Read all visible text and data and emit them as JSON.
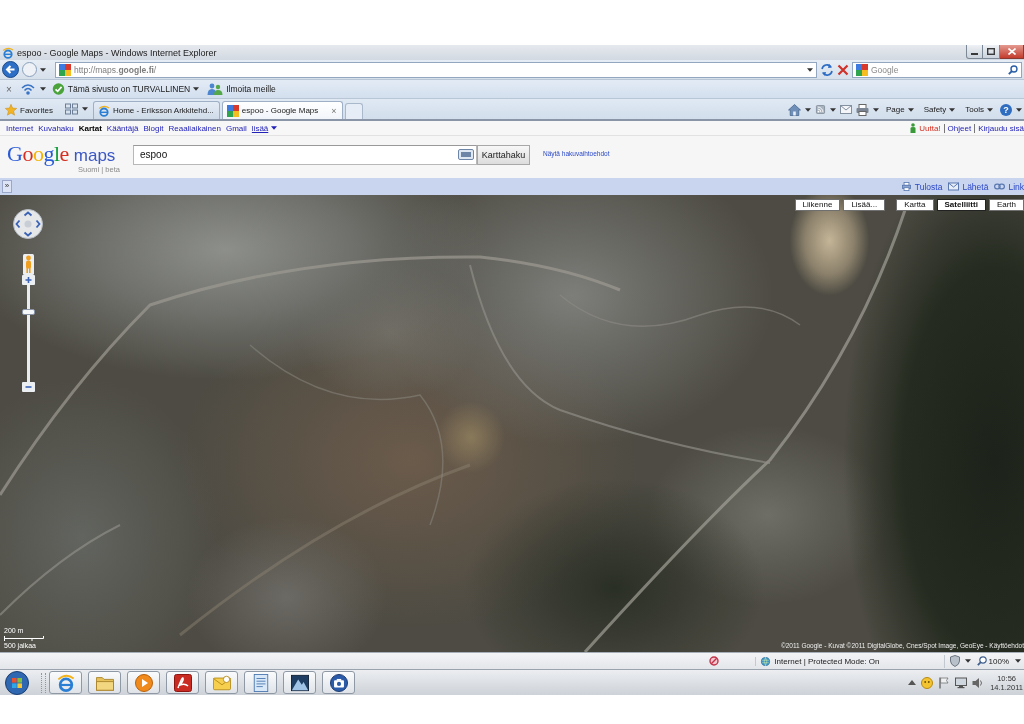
{
  "window": {
    "title": "espoo - Google Maps - Windows Internet Explorer"
  },
  "address_bar": {
    "url": "http://maps.**google.fi**/",
    "search_placeholder": "Google"
  },
  "toolbar": {
    "close": "×",
    "security_status": "Tämä sivusto on TURVALLINEN",
    "report": "Ilmoita meille"
  },
  "favorites_bar": {
    "favorites": "Favorites",
    "tabs": [
      {
        "title": "Home - Eriksson Arkkitehd...",
        "selected": false
      },
      {
        "title": "espoo - Google Maps",
        "selected": true
      }
    ],
    "tab_close": "×",
    "commands": [
      "Page",
      "Safety",
      "Tools"
    ],
    "help": "?"
  },
  "google_bar": {
    "links": [
      {
        "label": "Internet",
        "selected": false
      },
      {
        "label": "Kuvahaku",
        "selected": false
      },
      {
        "label": "Kartat",
        "selected": true
      },
      {
        "label": "Kääntäjä",
        "selected": false
      },
      {
        "label": "Blogit",
        "selected": false
      },
      {
        "label": "Reaaliaikainen",
        "selected": false
      },
      {
        "label": "Gmail",
        "selected": false
      }
    ],
    "more": "lisää",
    "user_links": [
      {
        "label": "Uutta!",
        "kind": "new"
      },
      {
        "label": "Ohjeet",
        "kind": "link"
      },
      {
        "label": "Kirjaudu sisä",
        "kind": "link"
      }
    ]
  },
  "maps_header": {
    "logo": "Google",
    "product": "maps",
    "subtitle": "Suomi | beta",
    "search_value": "espoo",
    "search_button": "Karttahaku",
    "options_link": "Näytä hakuvaihtoehdot"
  },
  "panel_bar": {
    "toggle": "»",
    "actions": [
      {
        "label": "Tulosta",
        "kind": "print"
      },
      {
        "label": "Lähetä",
        "kind": "send"
      },
      {
        "label": "Link",
        "kind": "link"
      }
    ]
  },
  "map": {
    "overlay_buttons": [
      {
        "label": "Liikenne",
        "selected": false
      },
      {
        "label": "Lisää...",
        "selected": false
      }
    ],
    "type_buttons": [
      {
        "label": "Kartta",
        "selected": false
      },
      {
        "label": "Satelliitti",
        "selected": true
      },
      {
        "label": "Earth",
        "selected": false
      }
    ],
    "zoom": {
      "level": 0.74
    },
    "scale": {
      "metric": "200 m",
      "imperial": "500 jalkaa"
    },
    "copyright": "©2011 Google - Kuvat ©2011 DigitalGlobe, Cnes/Spot Image, GeoEye - Käyttöehdot"
  },
  "status_bar": {
    "zone": "Internet | Protected Mode: On",
    "zoom": "100%"
  },
  "taskbar": {
    "time": "10:56",
    "date": "14.1.2011"
  }
}
